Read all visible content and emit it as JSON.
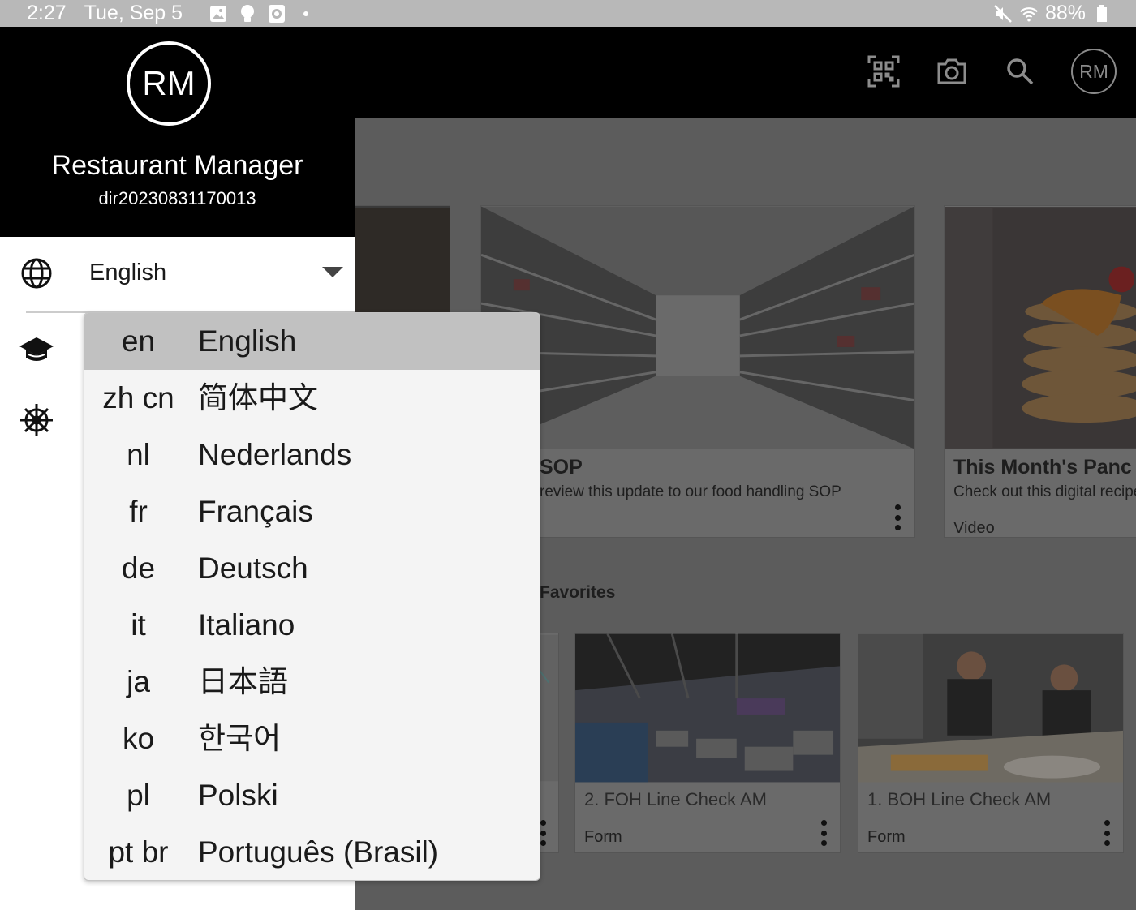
{
  "status_bar": {
    "time": "2:27",
    "date": "Tue, Sep 5",
    "battery": "88%",
    "icons": [
      "gallery-icon",
      "bulb-icon",
      "timer-icon",
      "dot-icon",
      "mute-icon",
      "wifi-icon",
      "battery-icon"
    ]
  },
  "app_bar": {
    "actions": [
      "qr-scan-icon",
      "camera-icon",
      "search-icon"
    ],
    "avatar_initials": "RM"
  },
  "drawer": {
    "avatar_initials": "RM",
    "user_name": "Restaurant Manager",
    "user_id": "dir20230831170013",
    "language_selected": "English",
    "menu_icons": [
      "graduation-cap-icon",
      "ship-wheel-icon"
    ]
  },
  "language_dropdown": {
    "items": [
      {
        "code": "en",
        "name": "English",
        "selected": true
      },
      {
        "code": "zh cn",
        "name": "简体中文",
        "selected": false
      },
      {
        "code": "nl",
        "name": "Nederlands",
        "selected": false
      },
      {
        "code": "fr",
        "name": "Français",
        "selected": false
      },
      {
        "code": "de",
        "name": "Deutsch",
        "selected": false
      },
      {
        "code": "it",
        "name": "Italiano",
        "selected": false
      },
      {
        "code": "ja",
        "name": "日本語",
        "selected": false
      },
      {
        "code": "ko",
        "name": "한국어",
        "selected": false
      },
      {
        "code": "pl",
        "name": "Polski",
        "selected": false
      },
      {
        "code": "pt br",
        "name": "Português (Brasil)",
        "selected": false
      }
    ]
  },
  "content": {
    "cards_top": [
      {
        "title": "SOP",
        "subtitle": "review this update to our food handling SOP",
        "type": ""
      },
      {
        "title": "This Month's Panc",
        "subtitle": "Check out this digital recipe",
        "type": "Video"
      }
    ],
    "favorites_title": "Favorites",
    "cards_favorites": [
      {
        "name": "2. FOH Line Check AM",
        "type": "Form"
      },
      {
        "name": "1. BOH Line Check AM",
        "type": "Form"
      }
    ]
  },
  "colors": {
    "header_bg": "#000000",
    "status_bar_bg": "#b8b8b8",
    "selected_item_bg": "#c1c1c1",
    "dropdown_bg": "#f4f4f4",
    "scrim_content": "#5c5c5c"
  }
}
